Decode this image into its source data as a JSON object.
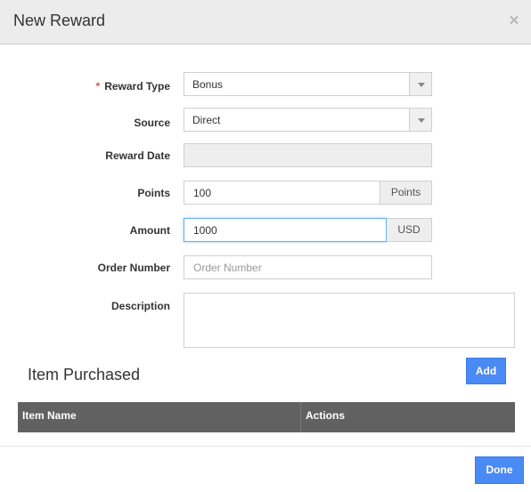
{
  "modal": {
    "title": "New Reward",
    "close_icon": "close-x-icon"
  },
  "form": {
    "reward_type": {
      "label": "Reward Type",
      "required": true,
      "required_marker": "*",
      "value": "Bonus"
    },
    "source": {
      "label": "Source",
      "value": "Direct"
    },
    "reward_date": {
      "label": "Reward Date",
      "value": "",
      "disabled": true
    },
    "points": {
      "label": "Points",
      "value": "100",
      "addon": "Points"
    },
    "amount": {
      "label": "Amount",
      "value": "1000",
      "addon": "USD",
      "focused": true
    },
    "order_number": {
      "label": "Order Number",
      "value": "",
      "placeholder": "Order Number"
    },
    "description": {
      "label": "Description",
      "value": ""
    }
  },
  "items_section": {
    "title": "Item Purchased",
    "add_label": "Add",
    "columns": [
      "Item Name",
      "Actions"
    ],
    "rows": []
  },
  "footer": {
    "done_label": "Done"
  },
  "colors": {
    "primary": "#4a8af4",
    "required": "#d9534f",
    "table_header": "#616161",
    "header_bg": "#ececec"
  }
}
